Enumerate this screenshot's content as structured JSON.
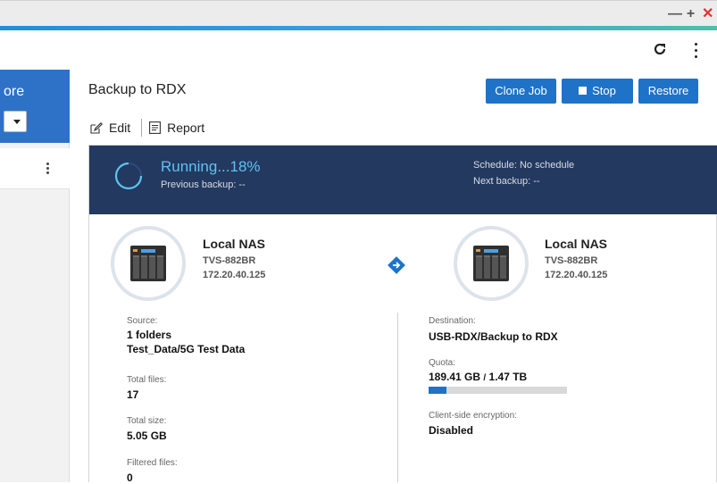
{
  "window": {
    "minimize": "—",
    "maximize": "+",
    "close": "✕"
  },
  "sidebar": {
    "title": "ore"
  },
  "job": {
    "title": "Backup to RDX",
    "buttons": {
      "clone": "Clone Job",
      "stop": "Stop",
      "restore": "Restore"
    },
    "actions": {
      "edit": "Edit",
      "report": "Report"
    },
    "status": {
      "running": "Running...18%",
      "previous": "Previous backup: --",
      "schedule": "Schedule: No schedule",
      "next": "Next backup: --"
    },
    "source_nas": {
      "name": "Local NAS",
      "model": "TVS-882BR",
      "ip": "172.20.40.125"
    },
    "dest_nas": {
      "name": "Local NAS",
      "model": "TVS-882BR",
      "ip": "172.20.40.125"
    },
    "source": {
      "label": "Source:",
      "folders": "1 folders",
      "path": "Test_Data/5G Test Data",
      "total_files_label": "Total files:",
      "total_files": "17",
      "total_size_label": "Total size:",
      "total_size": "5.05 GB",
      "filtered_label": "Filtered files:",
      "filtered": "0"
    },
    "destination": {
      "label": "Destination:",
      "path": "USB-RDX/Backup to RDX",
      "quota_label": "Quota:",
      "quota_used": "189.41 GB",
      "quota_sep": "/",
      "quota_total": "1.47 TB",
      "quota_fraction": 0.13,
      "encryption_label": "Client-side encryption:",
      "encryption": "Disabled"
    }
  },
  "colors": {
    "accent": "#1e73c8",
    "banner": "#23395f",
    "running": "#5cc3f2",
    "close": "#e03131"
  }
}
